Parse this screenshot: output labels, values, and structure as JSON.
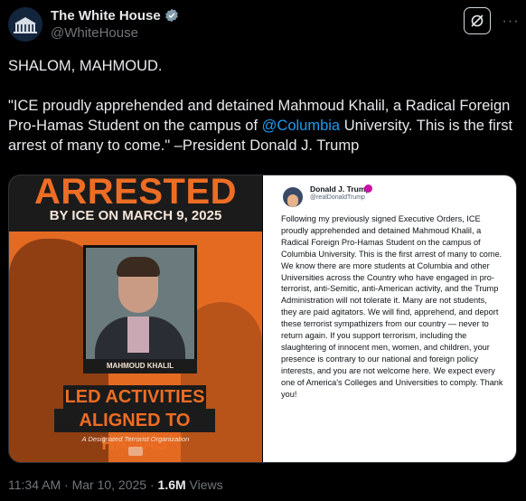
{
  "account": {
    "name": "The White House",
    "handle": "@WhiteHouse",
    "verified_color": "#829aab"
  },
  "actions": {
    "grok_icon": "grok-icon",
    "more_label": "···"
  },
  "post": {
    "line1": "SHALOM, MAHMOUD.",
    "quote_part1": "\"ICE proudly apprehended and detained Mahmoud Khalil, a Radical Foreign Pro-Hamas Student on the campus of ",
    "mention": "@Columbia",
    "quote_part2": " University. This is the first arrest of many to come.\" –President Donald J. Trump"
  },
  "graphic": {
    "headline": "ARRESTED",
    "subheadline": "BY ICE ON MARCH 9, 2025",
    "person_label": "MAHMOUD KHALIL",
    "banner_line1": "LED ACTIVITIES",
    "banner_line2": "ALIGNED TO HAMAS",
    "caption": "A Designated Terrorist Organization",
    "accent": "#e46a22"
  },
  "embedded_post": {
    "name": "Donald J. Trump",
    "handle": "@realDonaldTrump",
    "body": "Following my previously signed Executive Orders, ICE proudly apprehended and detained Mahmoud Khalil, a Radical Foreign Pro-Hamas Student on the campus of Columbia University. This is the first arrest of many to come. We know there are more students at Columbia and other Universities across the Country who have engaged in pro-terrorist, anti-Semitic, anti-American activity, and the Trump Administration will not tolerate it. Many are not students, they are paid agitators. We will find, apprehend, and deport these terrorist sympathizers from our country — never to return again. If you support terrorism, including the slaughtering of innocent men, women, and children, your presence is contrary to our national and foreign policy interests, and you are not welcome here. We expect every one of America's Colleges and Universities to comply. Thank you!"
  },
  "meta": {
    "time": "11:34 AM",
    "separator": " · ",
    "date": "Mar 10, 2025",
    "views_count": "1.6M",
    "views_label": " Views"
  }
}
